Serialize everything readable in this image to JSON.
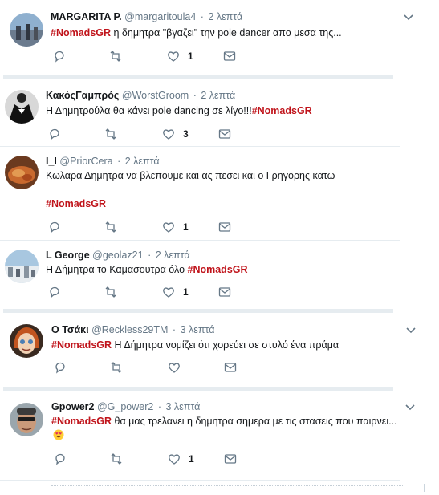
{
  "tweets": [
    {
      "name": "MARGARITA P.",
      "handle": "@margaritoula4",
      "time": "2 λεπτά",
      "hashtag_lead": "#NomadsGR",
      "text": " η δημητρα \"βγαζει\" την pole dancer απο μεσα της...",
      "like_count": "1"
    },
    {
      "name": "ΚακόςΓαμπρός",
      "handle": "@WorstGroom",
      "time": "2 λεπτά",
      "text": "Η Δημητρούλα θα κάνει pole dancing σε λίγο!!!",
      "hashtag_tail": "#NomadsGR",
      "like_count": "3"
    },
    {
      "name": "I_I",
      "handle": "@PriorCera",
      "time": "2 λεπτά",
      "text": "Κωλαρα Δημητρα να βλεπουμε και ας πεσει και ο Γρηγορης κατω",
      "hashtag_block": "#NomadsGR",
      "like_count": "1"
    },
    {
      "name": "L George",
      "handle": "@geolaz21",
      "time": "2 λεπτά",
      "text": "Η Δήμητρα το Καμασουτρα όλο ",
      "hashtag_tail": "#NomadsGR",
      "like_count": "1"
    },
    {
      "name": "Ο Τσάκι",
      "handle": "@Reckless29TM",
      "time": "3 λεπτά",
      "hashtag_lead": "#NomadsGR",
      "text": " Η Δήμητρα νομίζει ότι χορεύει σε στυλό ένα πράμα"
    },
    {
      "name": "Gpower2",
      "handle": "@G_power2",
      "time": "3 λεπτά",
      "hashtag_lead": "#NomadsGR",
      "text": " θα μας τρελανει η δημητρα σημερα με τις στασεις που παιρνει...",
      "emoji": "heart-eyes",
      "like_count": "1"
    }
  ],
  "colors": {
    "hashtag": "#c0141b",
    "icon": "#657786",
    "separator": "#e6ecf0"
  },
  "icons": [
    "reply-icon",
    "retweet-icon",
    "like-icon",
    "message-icon",
    "chevron-down-icon"
  ]
}
